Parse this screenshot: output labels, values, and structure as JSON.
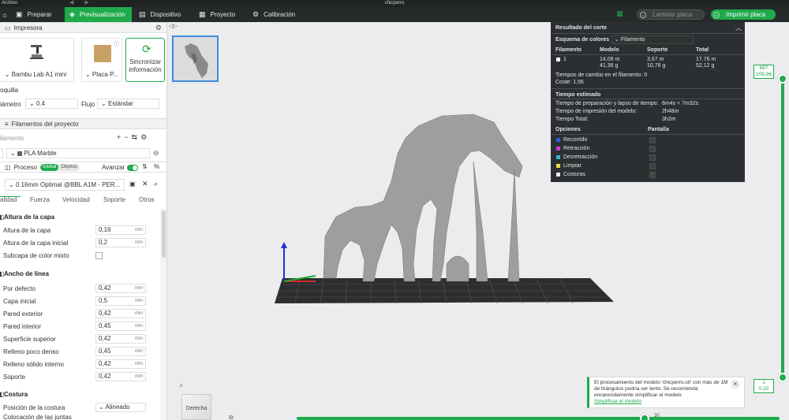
{
  "titlebar": {
    "menu": "Archivo",
    "title": "chicperro"
  },
  "nav": {
    "tabs": [
      {
        "label": "Preparar",
        "icon": "cube-icon"
      },
      {
        "label": "Previsualización",
        "icon": "preview-icon"
      },
      {
        "label": "Dispositivo",
        "icon": "device-icon"
      },
      {
        "label": "Proyecto",
        "icon": "project-icon"
      },
      {
        "label": "Calibración",
        "icon": "calibration-icon"
      }
    ],
    "slice_button": "Laminar placa",
    "print_button": "Imprimir placa"
  },
  "printer": {
    "section": "Impresora",
    "printer_name": "Bambu Lab A1 mini",
    "plate_name": "Placa P...",
    "sync_line1": "Sincronizar",
    "sync_line2": "información",
    "nozzle_label": "oquilla",
    "diameter_label": "iámetro",
    "diameter_value": "0.4",
    "flow_label": "Flujo",
    "flow_value": "Estándar"
  },
  "filaments": {
    "section": "Filamentos del proyecto",
    "filament_label": "ilamento",
    "filament_item": "PLA Marble"
  },
  "process": {
    "section": "Proceso",
    "pill_global": "Global",
    "pill_objects": "Objetos",
    "advanced": "Avanzar",
    "preset": "0.16mm Optimal @BBL A1M - PER...",
    "tabs": [
      "alidad",
      "Fuerza",
      "Velocidad",
      "Soporte",
      "Otros"
    ]
  },
  "params": {
    "layer_height_title": "Altura de la capa",
    "layer_height": {
      "label": "Altura de la capa",
      "value": "0,16",
      "unit": "mm"
    },
    "first_layer": {
      "label": "Altura de la capa inicial",
      "value": "0,2",
      "unit": "mm"
    },
    "color_sublayer": {
      "label": "Subcapa de color mixto"
    },
    "line_width_title": "Ancho de línea",
    "line_widths": [
      {
        "label": "Por defecto",
        "value": "0,42",
        "unit": "mm"
      },
      {
        "label": "Capa inicial",
        "value": "0,5",
        "unit": "mm"
      },
      {
        "label": "Pared exterior",
        "value": "0,42",
        "unit": "mm"
      },
      {
        "label": "Pared interior",
        "value": "0,45",
        "unit": "mm"
      },
      {
        "label": "Superficie superior",
        "value": "0,42",
        "unit": "mm"
      },
      {
        "label": "Relleno poco denso",
        "value": "0,45",
        "unit": "mm"
      },
      {
        "label": "Relleno sólido interno",
        "value": "0,42",
        "unit": "mm"
      },
      {
        "label": "Soporte",
        "value": "0,42",
        "unit": "mm"
      }
    ],
    "seam_title": "Costura",
    "seam_position": {
      "label": "Posición de la costura",
      "value": "Alineado"
    },
    "seam_joints": "Colocación de las juntas"
  },
  "result": {
    "title": "Resultado del corte",
    "scheme_label": "Esquema de colores",
    "scheme_value": "Filamento",
    "head": [
      "Filamento",
      "Modelo",
      "Soporte",
      "Total"
    ],
    "row_id": "1",
    "model": [
      "14,09 m",
      "41,36 g"
    ],
    "support": [
      "3,67 m",
      "10,76 g"
    ],
    "total": [
      "17,76 m",
      "52,12 g"
    ],
    "changes_label": "Tiempos de cambio en el filamento:",
    "changes_value": "0",
    "cost_label": "Coste:",
    "cost_value": "1,56",
    "time_title": "Tiempo estimado",
    "prep_label": "Tiempo de preparación y lapso de tiempo:",
    "prep_value": "6m4s + 7m32s",
    "model_time_label": "Tiempo de impresión del modelo:",
    "model_time_value": "2h48m",
    "total_time_label": "Tiempo Total:",
    "total_time_value": "3h2m",
    "options_label": "Opciones",
    "display_label": "Pantalla",
    "options": [
      {
        "label": "Recorrido",
        "color": "#3a5bd9",
        "checked": false
      },
      {
        "label": "Retracción",
        "color": "#c83bd0",
        "checked": false
      },
      {
        "label": "Desretracción",
        "color": "#38b6c9",
        "checked": false
      },
      {
        "label": "Limpiar",
        "color": "#e6e040",
        "checked": false
      },
      {
        "label": "Costuras",
        "color": "#e8e8e8",
        "checked": true
      }
    ]
  },
  "layers": {
    "top_value": "687",
    "top_height": "109,96",
    "bottom_value": "1",
    "bottom_height": "0,20",
    "h_value": "30"
  },
  "notification": {
    "text": "El procesamiento del modelo 'chicperro.stl' con más de 1M de triángulos podría ser lento. Se recomienda encarecidamente simplificar el modelo.",
    "link": "Simplificar el modelo"
  },
  "view_cube": {
    "label": "Derecha",
    "axis": "z"
  },
  "colors": {
    "accent": "#1faa4b",
    "dark": "#262a2b",
    "model": "#9b9b9b"
  }
}
